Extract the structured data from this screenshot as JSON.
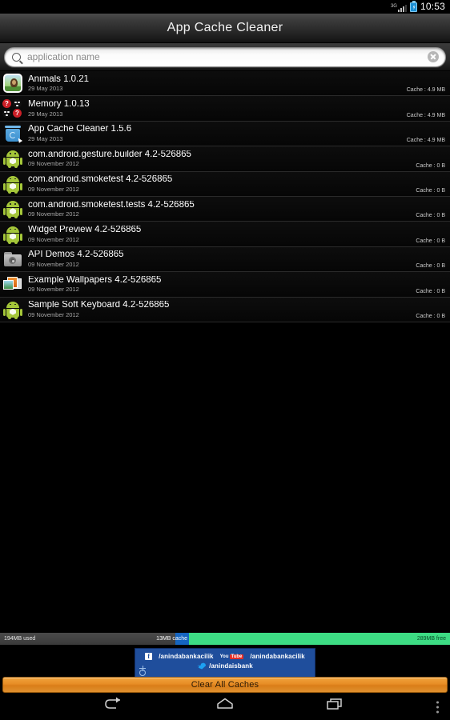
{
  "status_bar": {
    "network_label": "3G",
    "clock": "10:53",
    "signal_icon": "signal-bars-icon",
    "battery_icon": "battery-charging-icon"
  },
  "title_bar": {
    "title": "App Cache Cleaner"
  },
  "search": {
    "icon": "search-icon",
    "placeholder": "application name",
    "value": "application name",
    "clear_icon": "clear-circle-icon"
  },
  "apps": [
    {
      "name": "Animals 1.0.21",
      "date": "29 May 2013",
      "cache": "Cache : 4.9 MB",
      "icon": "animals-app-icon"
    },
    {
      "name": "Memory 1.0.13",
      "date": "29 May 2013",
      "cache": "Cache : 4.9 MB",
      "icon": "memory-app-icon"
    },
    {
      "name": "App Cache Cleaner 1.5.6",
      "date": "29 May 2013",
      "cache": "Cache : 4.9 MB",
      "icon": "app-cache-cleaner-icon"
    },
    {
      "name": "com.android.gesture.builder 4.2-526865",
      "date": "09 November 2012",
      "cache": "Cache : 0 B",
      "icon": "android-robot-icon"
    },
    {
      "name": "com.android.smoketest 4.2-526865",
      "date": "09 November 2012",
      "cache": "Cache : 0 B",
      "icon": "android-robot-icon"
    },
    {
      "name": "com.android.smoketest.tests 4.2-526865",
      "date": "09 November 2012",
      "cache": "Cache : 0 B",
      "icon": "android-robot-icon"
    },
    {
      "name": "Widget Preview 4.2-526865",
      "date": "09 November 2012",
      "cache": "Cache : 0 B",
      "icon": "android-robot-icon"
    },
    {
      "name": "API Demos 4.2-526865",
      "date": "09 November 2012",
      "cache": "Cache : 0 B",
      "icon": "folder-gear-icon"
    },
    {
      "name": "Example Wallpapers 4.2-526865",
      "date": "09 November 2012",
      "cache": "Cache : 0 B",
      "icon": "wallpapers-icon"
    },
    {
      "name": "Sample Soft Keyboard 4.2-526865",
      "date": "09 November 2012",
      "cache": "Cache : 0 B",
      "icon": "android-robot-icon"
    }
  ],
  "storage": {
    "used_label": "194MB used",
    "cache_label": "13MB cache",
    "free_label": "289MB free",
    "used_pct": 39,
    "cache_pct": 3,
    "free_pct": 58,
    "used_color": "#3f3f3f",
    "cache_color": "#1565c0",
    "free_color": "#3ddc84"
  },
  "ad": {
    "facebook_icon": "facebook-icon",
    "facebook_handle": "/anindabankacilik",
    "youtube_icon": "youtube-icon",
    "youtube_you": "You",
    "youtube_tube": "Tube",
    "youtube_handle": "/anindabankacilik",
    "twitter_icon": "twitter-icon",
    "twitter_handle": "/anindaisbank",
    "admob_icon": "admob-info-icon",
    "background_color": "#1f4e9c"
  },
  "clear_button": {
    "label": "Clear All Caches",
    "color": "#e78c25"
  },
  "nav_bar": {
    "back_icon": "back-icon",
    "home_icon": "home-icon",
    "recents_icon": "recent-apps-icon",
    "menu_icon": "overflow-menu-icon"
  }
}
